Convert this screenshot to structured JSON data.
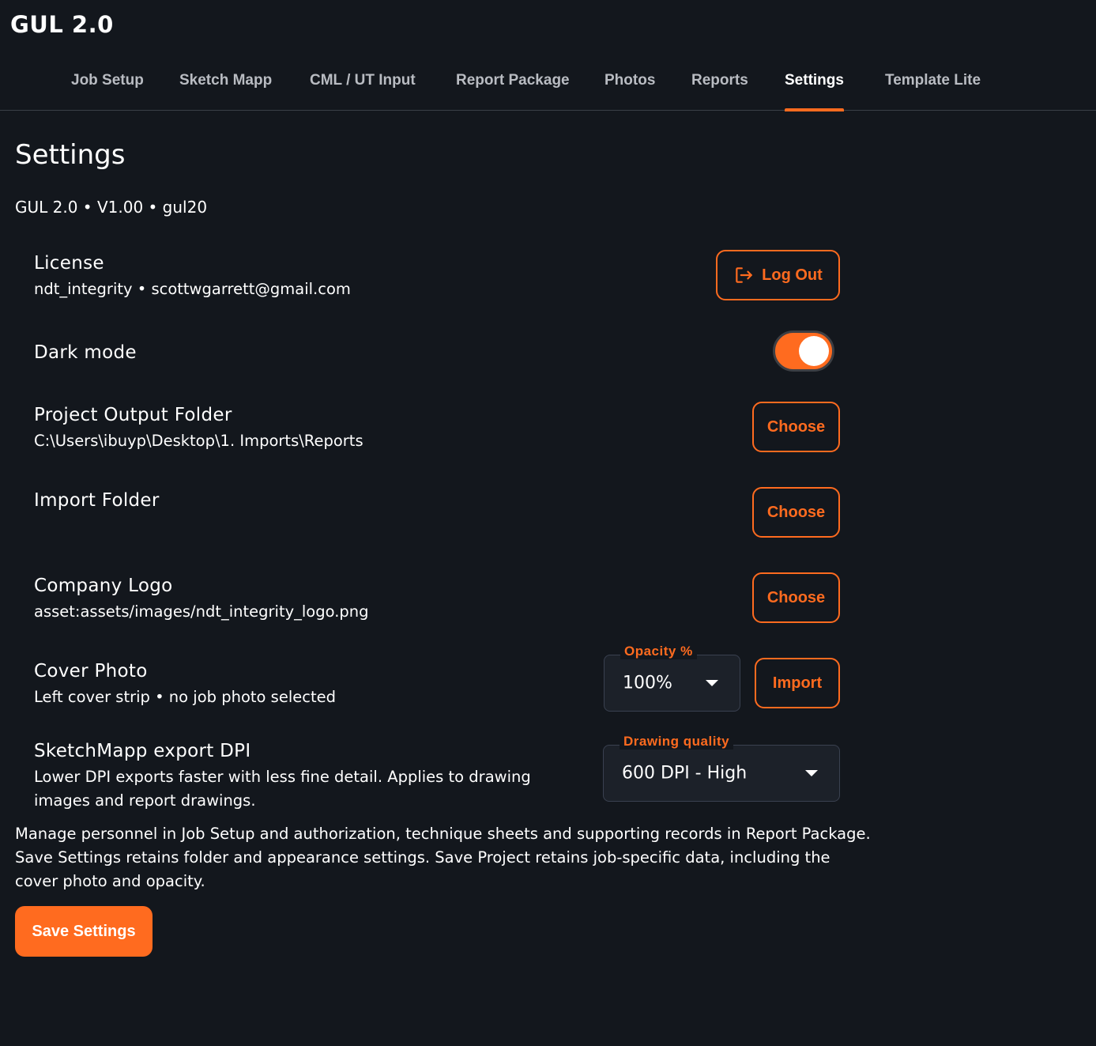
{
  "app": {
    "title": "GUL 2.0"
  },
  "tabs": [
    {
      "label": "Job Setup"
    },
    {
      "label": "Sketch Mapp"
    },
    {
      "label": "CML / UT Input"
    },
    {
      "label": "Report Package"
    },
    {
      "label": "Photos"
    },
    {
      "label": "Reports"
    },
    {
      "label": "Settings",
      "active": true
    },
    {
      "label": "Template Lite"
    }
  ],
  "page": {
    "title": "Settings",
    "version": "GUL 2.0 • V1.00 • gul20"
  },
  "license": {
    "title": "License",
    "detail": "ndt_integrity • scottwgarrett@gmail.com",
    "logout_label": "Log Out",
    "logout_icon": "logout-icon"
  },
  "dark_mode": {
    "title": "Dark mode",
    "enabled": true
  },
  "output_folder": {
    "title": "Project Output Folder",
    "path": "C:\\Users\\ibuyp\\Desktop\\1. Imports\\Reports",
    "button_label": "Choose"
  },
  "import_folder": {
    "title": "Import Folder",
    "button_label": "Choose"
  },
  "company_logo": {
    "title": "Company Logo",
    "path": "asset:assets/images/ndt_integrity_logo.png",
    "button_label": "Choose"
  },
  "cover_photo": {
    "title": "Cover Photo",
    "detail": "Left cover strip • no job photo selected",
    "opacity_label": "Opacity %",
    "opacity_value": "100%",
    "button_label": "Import"
  },
  "dpi": {
    "title": "SketchMapp export DPI",
    "detail": "Lower DPI exports faster with less fine detail. Applies to drawing images and report drawings.",
    "quality_label": "Drawing quality",
    "quality_value": "600 DPI - High"
  },
  "note": "Manage personnel in Job Setup and authorization, technique sheets and supporting records in Report Package. Save Settings retains folder and appearance settings. Save Project retains job-specific data, including the cover photo and opacity.",
  "save_button": "Save Settings",
  "colors": {
    "background": "#13171d",
    "accent": "#ff6b1f",
    "text": "#ffffff",
    "tab_inactive": "#b9bcc2"
  }
}
